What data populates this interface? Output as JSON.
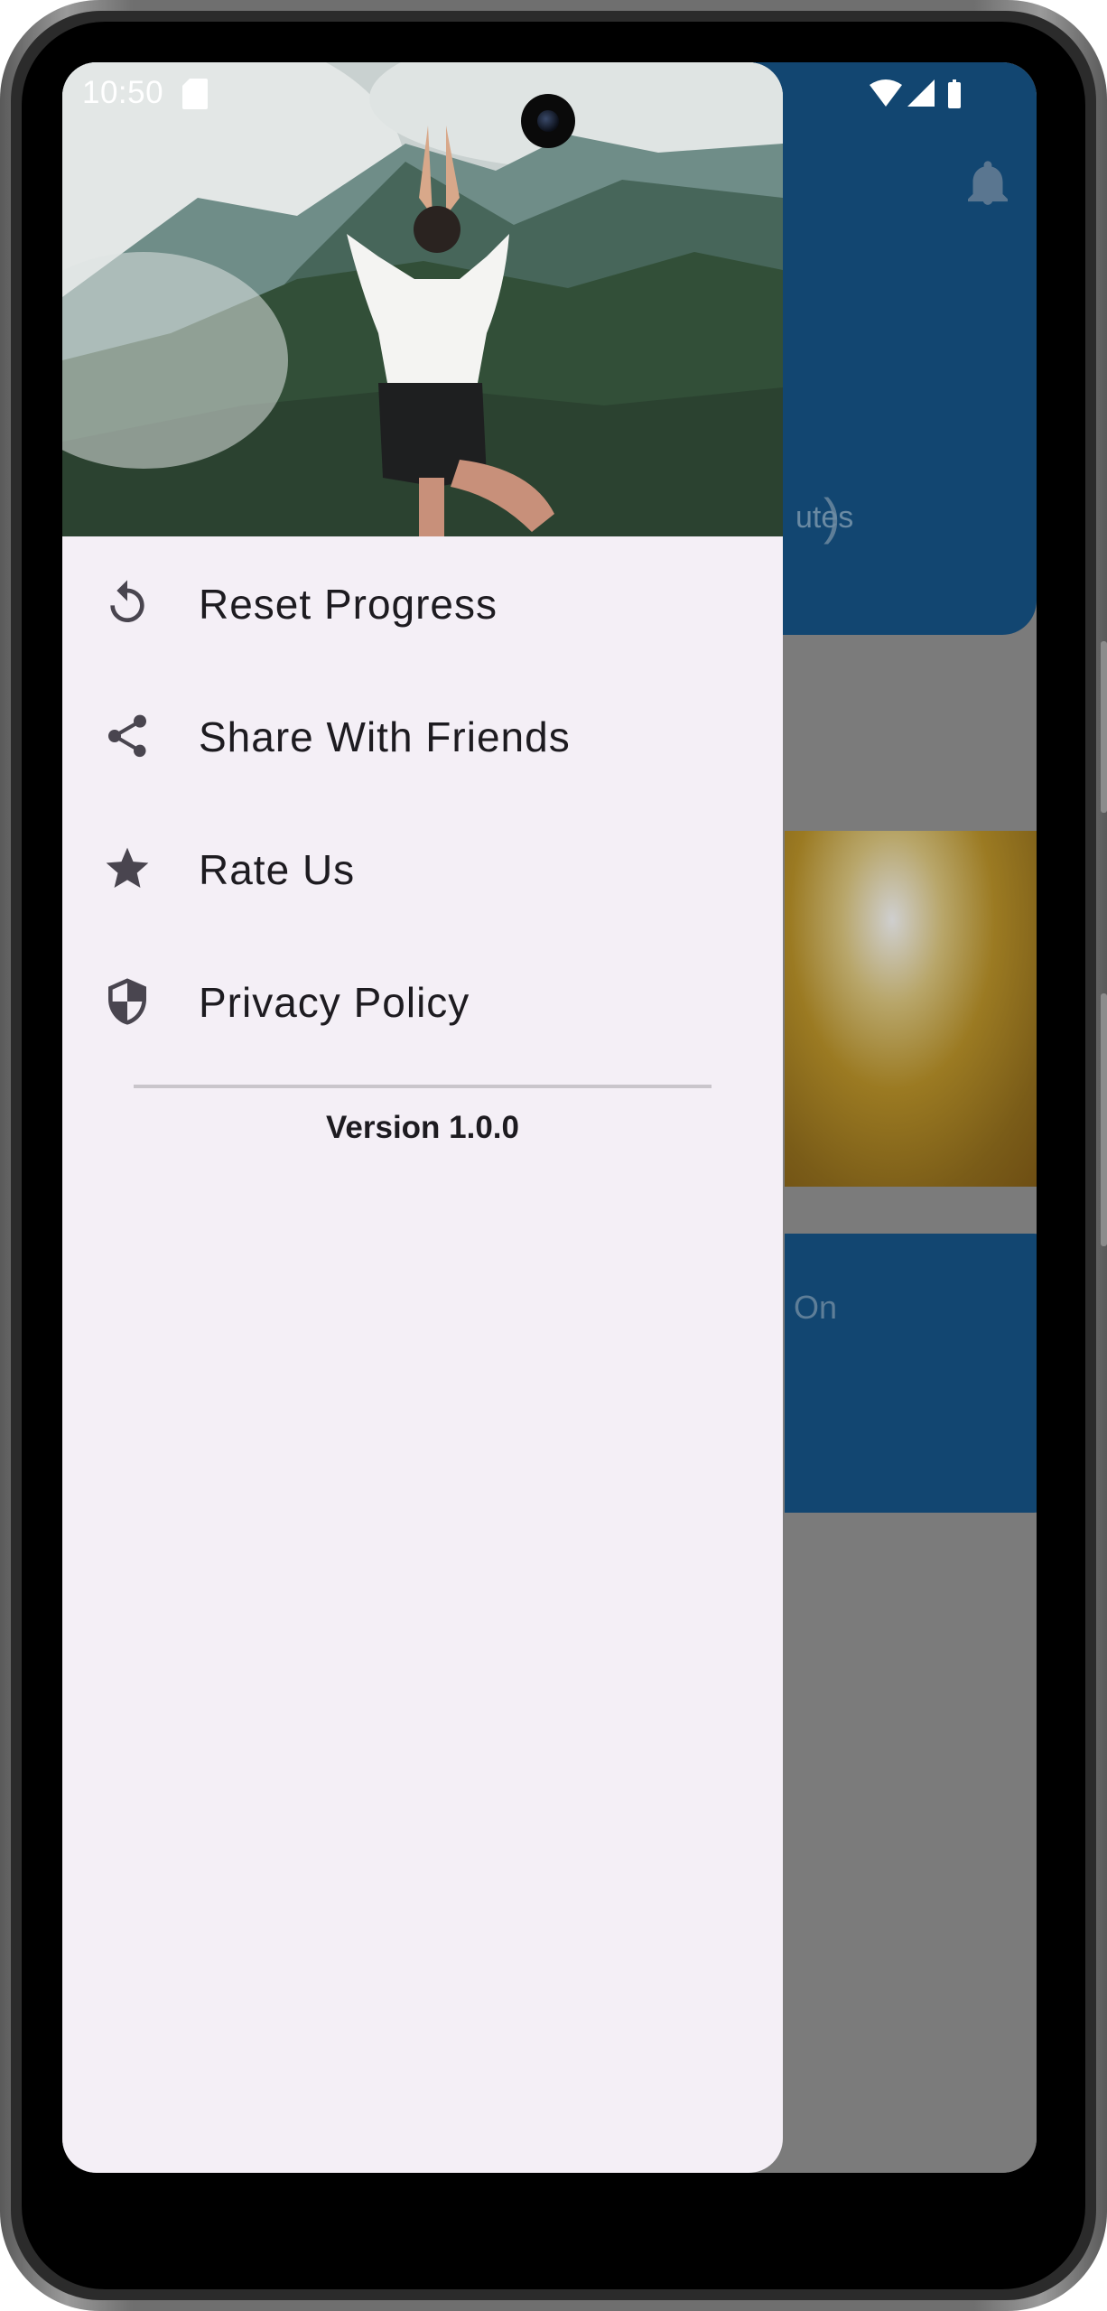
{
  "status_bar": {
    "time": "10:50",
    "icons": [
      "sd-card-icon",
      "wifi-icon",
      "signal-icon",
      "battery-icon"
    ]
  },
  "background_app": {
    "number_partial": ")",
    "minutes_partial": "utes",
    "card_text_partial": "On",
    "header_color": "#124671",
    "icons": [
      "bell-icon"
    ]
  },
  "drawer": {
    "hero_image": "yoga-mountain-photo",
    "menu": [
      {
        "label": "Reset Progress",
        "icon": "reset-icon"
      },
      {
        "label": "Share With Friends",
        "icon": "share-icon"
      },
      {
        "label": "Rate Us",
        "icon": "star-icon"
      },
      {
        "label": "Privacy Policy",
        "icon": "shield-icon"
      }
    ],
    "version": "Version 1.0.0",
    "background_color": "#f4eff6"
  }
}
